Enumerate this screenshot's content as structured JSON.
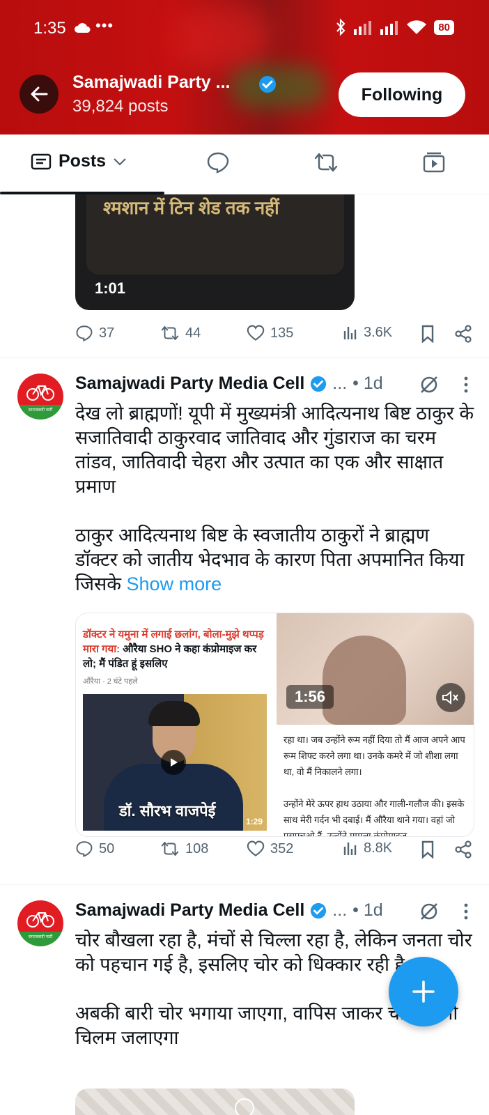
{
  "status_bar": {
    "time": "1:35",
    "dots": "•••",
    "battery": "80"
  },
  "header": {
    "name": "Samajwadi Party ...",
    "posts": "39,824 posts",
    "follow_label": "Following"
  },
  "tabs": {
    "posts_label": "Posts"
  },
  "top_video": {
    "caption": "श्मशान में टिन शेड तक नहीं",
    "duration": "1:01"
  },
  "top_actions": {
    "replies": "37",
    "reposts": "44",
    "likes": "135",
    "views": "3.6K"
  },
  "tweet1": {
    "author": "Samajwadi Party Media Cell",
    "ellipsis": "...",
    "time": "• 1d",
    "text": "देख लो ब्राह्मणों! यूपी में मुख्यमंत्री आदित्यनाथ बिष्ट ठाकुर के सजातिवादी ठाकुरवाद जातिवाद और गुंडाराज का चरम तांडव, जातिवादी चेहरा और उत्पात का एक और साक्षात प्रमाण\n\nठाकुर आदित्यनाथ बिष्ट के स्वजातीय ठाकुरों ने ब्राह्मण डॉक्टर को जातीय भेदभाव के कारण पिता अपमानित किया जिसके ",
    "show_more": "Show more",
    "media": {
      "headline_red": "डॉक्टर ने यमुना में लगाई छलांग, बोला-मुझे थप्पड़ मारा गया:",
      "headline_black": " औरैया SHO ने कहा कंप्रोमाइज कर लो; मैं पंडित हूं इसलिए",
      "sub": "औरैया · 2 घंटे पहले",
      "photo_name": "डॉ. सौरभ वाजपेई",
      "photo_duration": "1:29",
      "video_duration": "1:56",
      "article_text": "रहा था। जब उन्होंने रूम नहीं दिया तो मैं आज अपने आप रूम शिफ्ट करने लगा था। उनके कमरे में जो शीशा लगा था, वो मैं निकालने लगा।\n\nउन्होंने मेरे ऊपर हाथ उठाया और गाली-गलौज की। इसके साथ मेरी गर्दन भी दबाई। मैं औरैया थाने गया। वहां जो एसएचओ हैं, उन्होंने मामला कंप्रोमाइज"
    },
    "actions": {
      "replies": "50",
      "reposts": "108",
      "likes": "352",
      "views": "8.8K"
    }
  },
  "tweet2": {
    "author": "Samajwadi Party Media Cell",
    "ellipsis": "...",
    "time": "• 1d",
    "text": "चोर बौखला रहा है, मंचों से चिल्ला रहा है, लेकिन जनता चोर को पहचान गई है, इसलिए चोर को धिक्कार रही है\n\nअबकी बारी चोर भगाया जाएगा, वापिस जाकर चोर अपनी चिलम जलाएगा"
  },
  "avatar_tag": "समाजवादी पार्टी",
  "colors": {
    "accent": "#1d9bf0",
    "header_red": "#c40f10",
    "muted": "#536471"
  }
}
